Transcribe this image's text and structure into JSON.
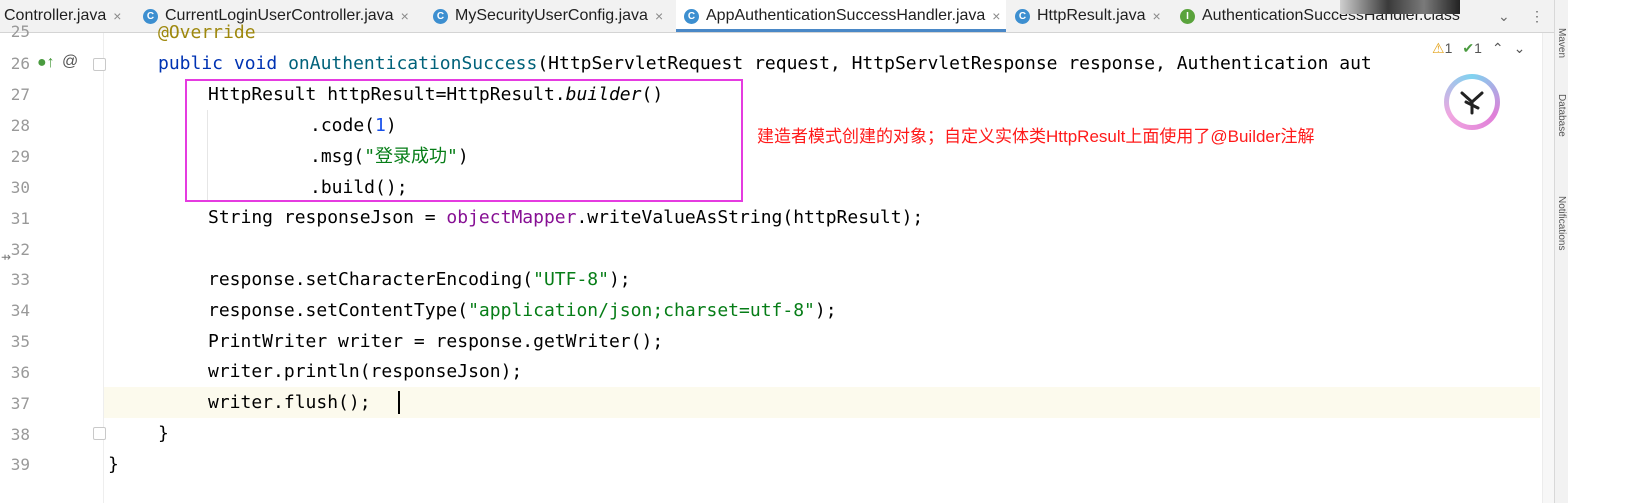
{
  "tabs": [
    {
      "label": "Controller.java",
      "icon": "",
      "active": false
    },
    {
      "label": "CurrentLoginUserController.java",
      "icon": "C",
      "active": false
    },
    {
      "label": "MySecurityUserConfig.java",
      "icon": "C",
      "active": false
    },
    {
      "label": "AppAuthenticationSuccessHandler.java",
      "icon": "C",
      "active": true
    },
    {
      "label": "HttpResult.java",
      "icon": "C",
      "active": false
    },
    {
      "label": "AuthenticationSuccessHandler.class",
      "icon": "I",
      "active": false
    }
  ],
  "tab_close": "×",
  "inspection": {
    "warnings": "1",
    "checks": "1"
  },
  "line_numbers": [
    "25",
    "26",
    "27",
    "28",
    "29",
    "30",
    "31",
    "32",
    "33",
    "34",
    "35",
    "36",
    "37",
    "38",
    "39"
  ],
  "code": {
    "l25": {
      "ann": "@Override"
    },
    "l26": {
      "kw1": "public",
      "kw2": "void",
      "method": "onAuthenticationSuccess",
      "rest": "(HttpServletRequest request, HttpServletResponse response, Authentication aut"
    },
    "l27": {
      "a": "HttpResult httpResult=HttpResult.",
      "b": "builder",
      "c": "()"
    },
    "l28": {
      "a": ".code(",
      "num": "1",
      "c": ")"
    },
    "l29": {
      "a": ".msg(",
      "str": "\"登录成功\"",
      "c": ")"
    },
    "l30": {
      "a": ".build();"
    },
    "l31": {
      "a": "String responseJson = ",
      "fld": "objectMapper",
      "c": ".writeValueAsString(httpResult);"
    },
    "l33": {
      "a": "response.setCharacterEncoding(",
      "str": "\"UTF-8\"",
      "c": ");"
    },
    "l34": {
      "a": "response.setContentType(",
      "str": "\"application/json;charset=utf-8\"",
      "c": ");"
    },
    "l35": {
      "a": "PrintWriter writer = response.getWriter();"
    },
    "l36": {
      "a": "writer.println(responseJson);"
    },
    "l37": {
      "a": "writer.flush();"
    },
    "l38": {
      "a": "}"
    },
    "l39": {
      "a": "}"
    }
  },
  "annotation_note": "建造者模式创建的对象；自定义实体类HttpResult上面使用了@Builder注解",
  "side_labels": {
    "maven": "Maven",
    "database": "Database",
    "notifications": "Notifications"
  },
  "colors": {
    "keyword": "#0033b3",
    "string": "#067d17",
    "number": "#1750eb",
    "field": "#871094",
    "highlight_box": "#e53be0",
    "note": "#ff1a1a"
  }
}
